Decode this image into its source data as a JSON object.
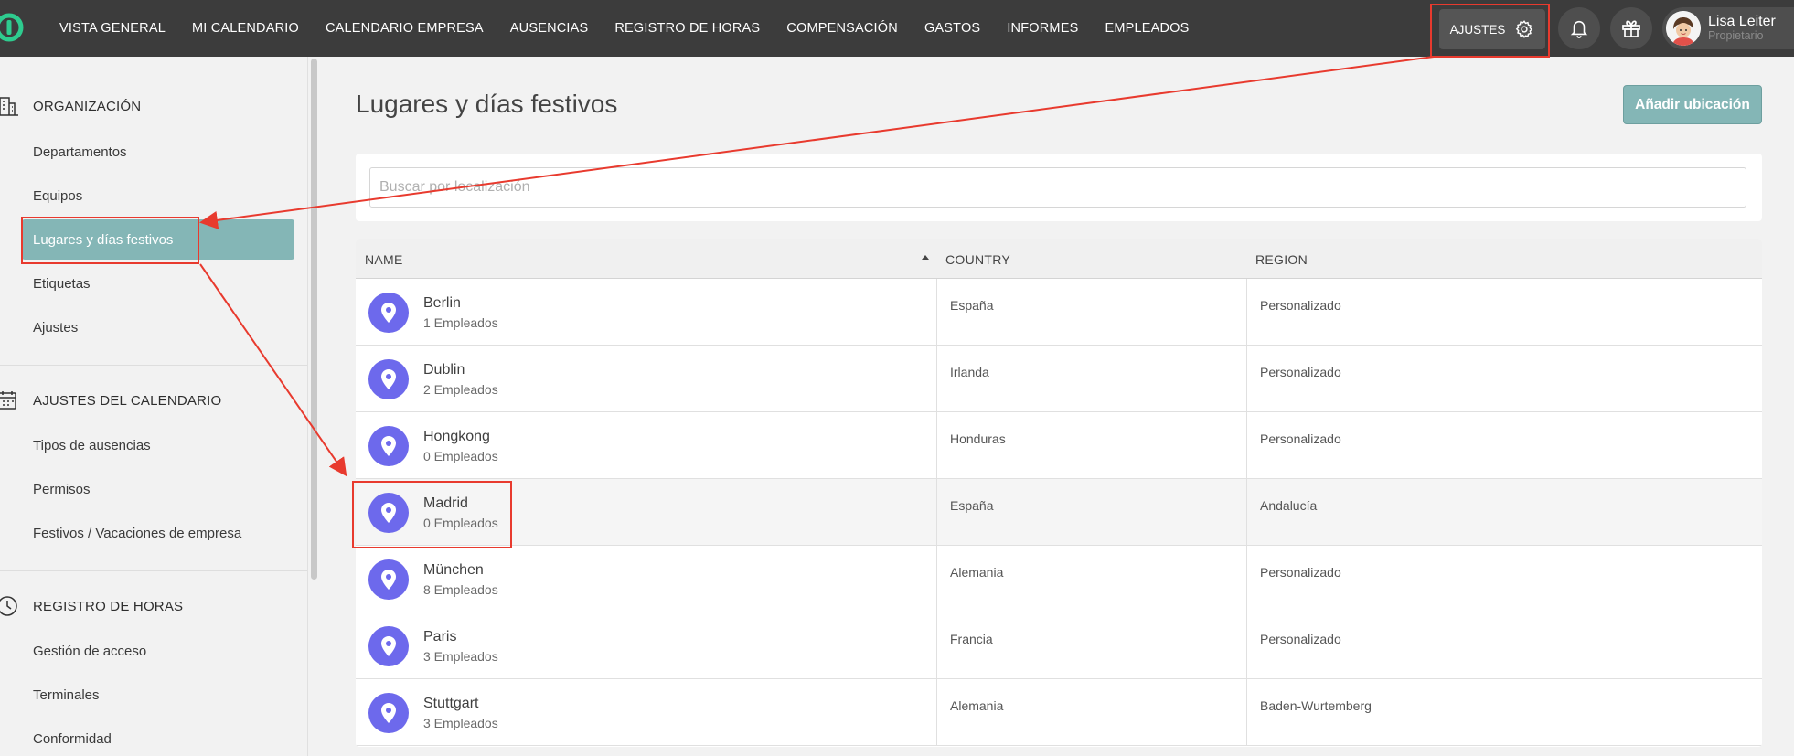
{
  "topbar": {
    "nav": [
      "VISTA GENERAL",
      "MI CALENDARIO",
      "CALENDARIO EMPRESA",
      "AUSENCIAS",
      "REGISTRO DE HORAS",
      "COMPENSACIÓN",
      "GASTOS",
      "INFORMES",
      "EMPLEADOS"
    ],
    "ajustes_label": "AJUSTES",
    "user_name": "Lisa Leiter",
    "user_role": "Propietario"
  },
  "sidebar": {
    "org_title": "ORGANIZACIÓN",
    "org_items": [
      "Departamentos",
      "Equipos",
      "Lugares y días festivos",
      "Etiquetas",
      "Ajustes"
    ],
    "cal_title": "AJUSTES DEL CALENDARIO",
    "cal_items": [
      "Tipos de ausencias",
      "Permisos",
      "Festivos / Vacaciones de empresa"
    ],
    "time_title": "REGISTRO DE HORAS",
    "time_items": [
      "Gestión de acceso",
      "Terminales",
      "Conformidad"
    ]
  },
  "main": {
    "title": "Lugares y días festivos",
    "add_button": "Añadir ubicación",
    "search_placeholder": "Buscar por localización",
    "columns": [
      "NAME",
      "COUNTRY",
      "REGION"
    ],
    "rows": [
      {
        "name": "Berlin",
        "employees": "1 Empleados",
        "country": "España",
        "region": "Personalizado"
      },
      {
        "name": "Dublin",
        "employees": "2 Empleados",
        "country": "Irlanda",
        "region": "Personalizado"
      },
      {
        "name": "Hongkong",
        "employees": "0 Empleados",
        "country": "Honduras",
        "region": "Personalizado"
      },
      {
        "name": "Madrid",
        "employees": "0 Empleados",
        "country": "España",
        "region": "Andalucía"
      },
      {
        "name": "München",
        "employees": "8 Empleados",
        "country": "Alemania",
        "region": "Personalizado"
      },
      {
        "name": "Paris",
        "employees": "3 Empleados",
        "country": "Francia",
        "region": "Personalizado"
      },
      {
        "name": "Stuttgart",
        "employees": "3 Empleados",
        "country": "Alemania",
        "region": "Baden-Wurtemberg"
      }
    ]
  },
  "colors": {
    "topbar": "#3c3c3c",
    "accent_teal": "#84b6b6",
    "pin_purple": "#6d69ec",
    "annotation_red": "#e83a2e"
  }
}
